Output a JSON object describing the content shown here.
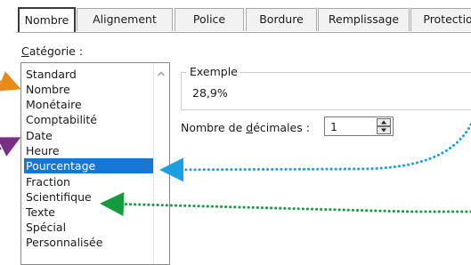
{
  "tabs": [
    "Nombre",
    "Alignement",
    "Police",
    "Bordure",
    "Remplissage",
    "Protection"
  ],
  "category_label_underlined": "C",
  "category_label_rest": "atégorie :",
  "categories": [
    "Standard",
    "Nombre",
    "Monétaire",
    "Comptabilité",
    "Date",
    "Heure",
    "Pourcentage",
    "Fraction",
    "Scientifique",
    "Texte",
    "Spécial",
    "Personnalisée"
  ],
  "selected_category": "Pourcentage",
  "sample": {
    "label": "Exemple",
    "value": "28,9%"
  },
  "decimals": {
    "label_prefix": "Nombre de ",
    "label_underlined": "d",
    "label_suffix": "écimales :",
    "value": "1"
  },
  "colors": {
    "selection": "#1777d3",
    "arrow_orange": "#e8891a",
    "arrow_purple": "#7a2e86",
    "arrow_blue": "#1aa0e0",
    "arrow_green": "#169a3e"
  },
  "icons": [
    "scroll-up-arrow-icon",
    "spin-up-icon",
    "spin-down-icon"
  ]
}
